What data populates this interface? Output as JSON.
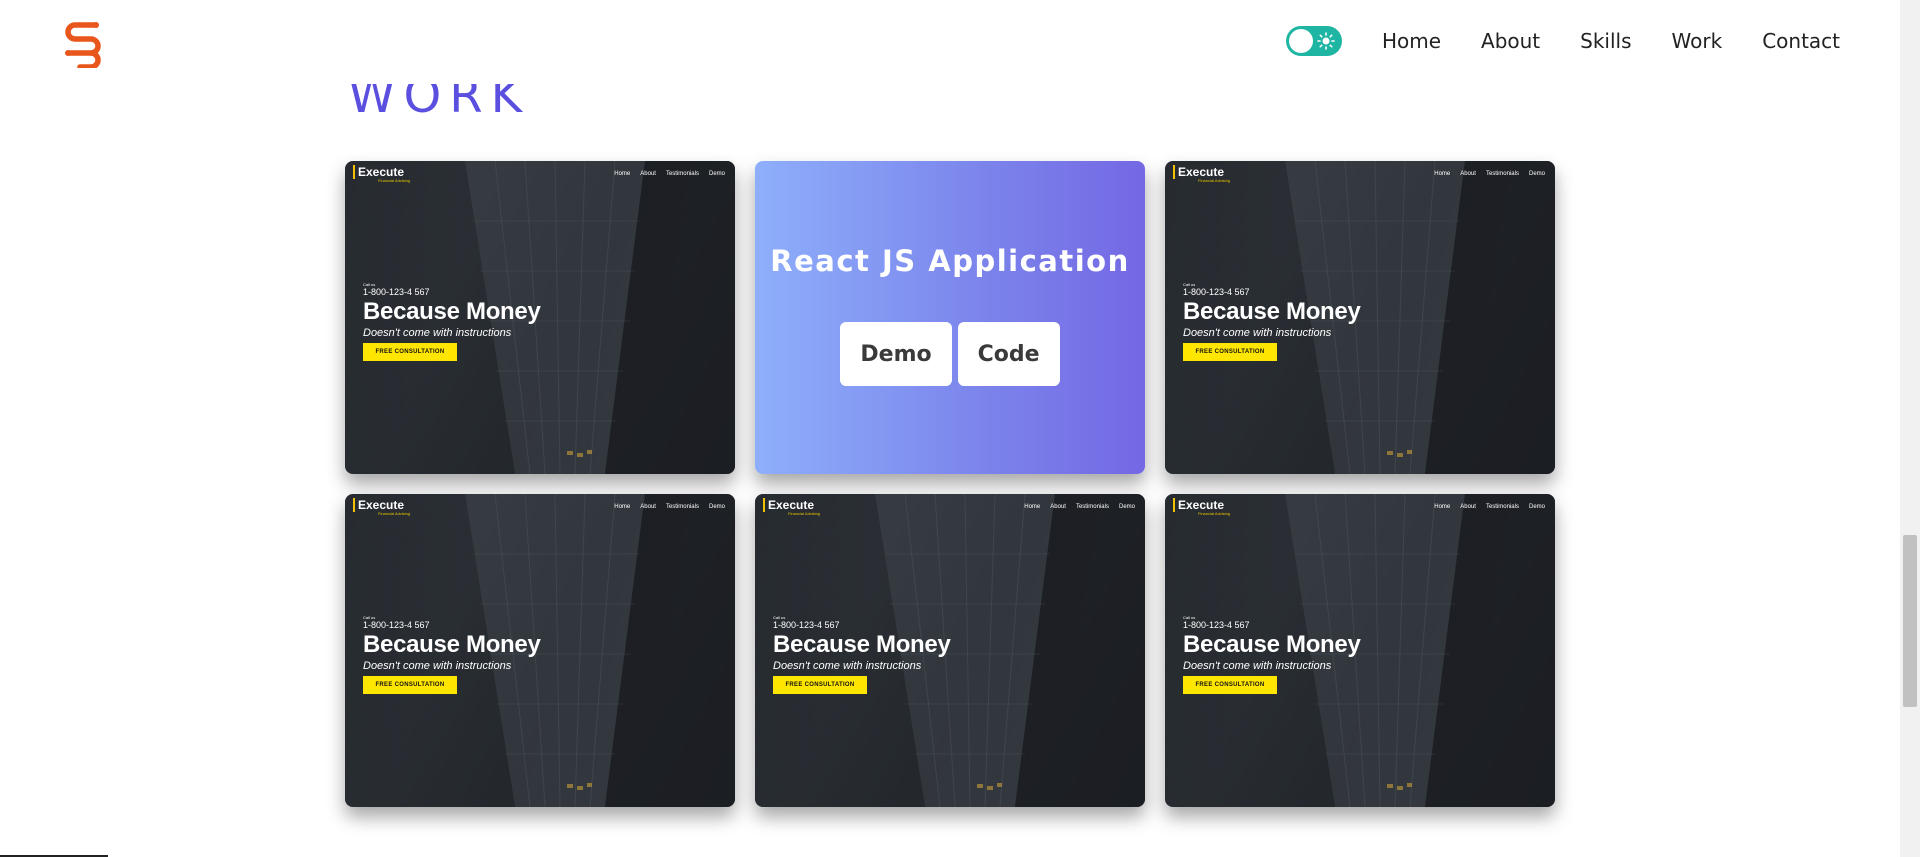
{
  "header": {
    "logo_icon": "s-link-logo-icon",
    "brand_color": "#e8561b",
    "theme_toggle": {
      "state": "light",
      "icon": "sun-icon",
      "color": "#1fb5a3"
    },
    "nav": [
      {
        "label": "Home"
      },
      {
        "label": "About"
      },
      {
        "label": "Skills"
      },
      {
        "label": "Work"
      },
      {
        "label": "Contact"
      }
    ]
  },
  "section": {
    "title": "WORK",
    "title_color": "#5b4fe0"
  },
  "preview_template": {
    "brand": "Execute",
    "tagline": "Financial Advising",
    "menu": [
      "Home",
      "About",
      "Testimonials",
      "Demo"
    ],
    "call_label": "Call us",
    "phone": "1-800-123-4 567",
    "headline": "Because Money",
    "subheadline": "Doesn't come with instructions",
    "cta": "FREE CONSULTATION",
    "cta_color": "#ffe600"
  },
  "projects": [
    {
      "state": "preview"
    },
    {
      "state": "hover",
      "title": "React JS Application",
      "demo_label": "Demo",
      "code_label": "Code"
    },
    {
      "state": "preview"
    },
    {
      "state": "preview"
    },
    {
      "state": "preview"
    },
    {
      "state": "preview"
    }
  ]
}
